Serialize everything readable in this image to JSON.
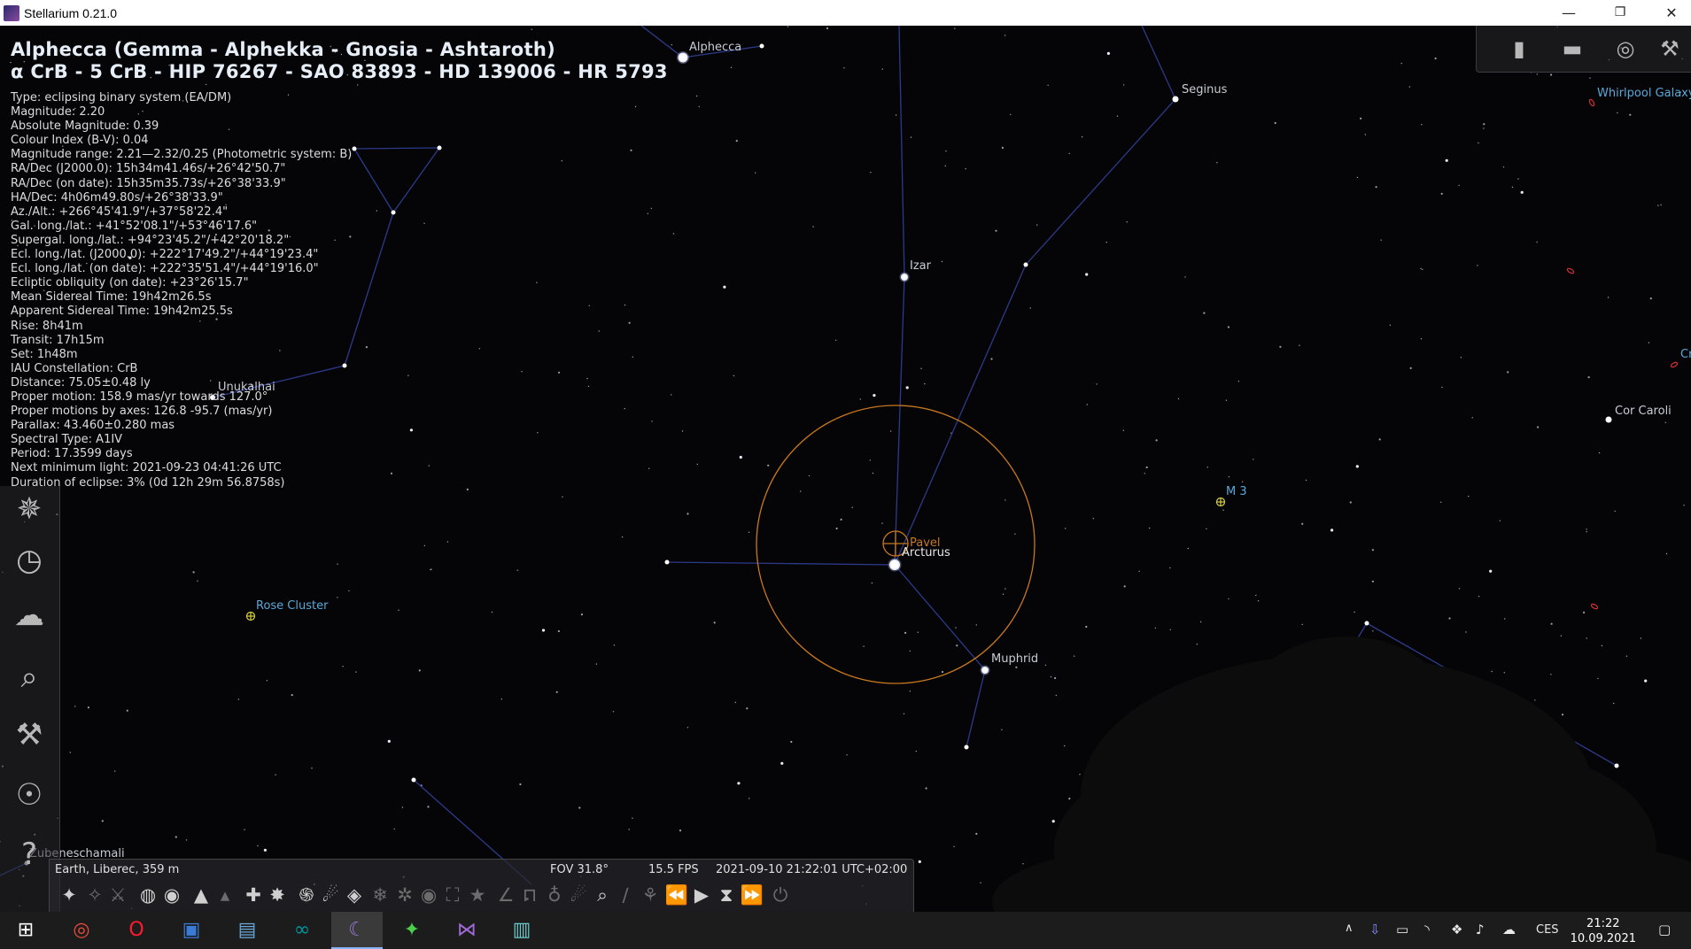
{
  "window": {
    "title": "Stellarium 0.21.0",
    "minimize_glyph": "—",
    "restore_glyph": "❐",
    "close_glyph": "✕"
  },
  "object": {
    "name_line": "Alphecca (Gemma - Alphekka - Gnosia - Ashtaroth)",
    "designations_line": "α CrB - 5 CrB - HIP 76267 - SAO 83893 - HD 139006 - HR 5793",
    "info_lines": [
      "Type: eclipsing binary system (EA/DM)",
      "Magnitude: 2.20",
      "Absolute Magnitude: 0.39",
      "Colour Index (B-V): 0.04",
      "Magnitude range: 2.21—2.32/0.25 (Photometric system: B)",
      "RA/Dec (J2000.0): 15h34m41.46s/+26°42'50.7\"",
      "RA/Dec (on date): 15h35m35.73s/+26°38'33.9\"",
      "HA/Dec: 4h06m49.80s/+26°38'33.9\"",
      "Az./Alt.: +266°45'41.9\"/+37°58'22.4\"",
      "Gal. long./lat.: +41°52'08.1\"/+53°46'17.6\"",
      "Supergal. long./lat.: +94°23'45.2\"/+42°20'18.2\"",
      "Ecl. long./lat. (J2000.0): +222°17'49.2\"/+44°19'23.4\"",
      "Ecl. long./lat. (on date): +222°35'51.4\"/+44°19'16.0\"",
      "Ecliptic obliquity (on date): +23°26'15.7\"",
      "Mean Sidereal Time: 19h42m26.5s",
      "Apparent Sidereal Time: 19h42m25.5s",
      "Rise: 8h41m",
      "Transit: 17h15m",
      "Set: 1h48m",
      "IAU Constellation: CrB",
      "Distance: 75.05±0.48 ly",
      "Proper motion: 158.9 mas/yr towards 127.0°",
      "Proper motions by axes: 126.8 -95.7 (mas/yr)",
      "Parallax: 43.460±0.280 mas",
      "Spectral Type: A1IV",
      "Period: 17.3599 days",
      "Next minimum light: 2021-09-23 04:41:26 UTC",
      "Duration of eclipse: 3% (0d 12h 29m 56.8758s)"
    ]
  },
  "sky_labels": {
    "alphecca": "Alphecca",
    "seginus": "Seginus",
    "izar": "Izar",
    "unukalhai": "Unukalhai",
    "pavel": "Pavel",
    "arcturus": "Arcturus",
    "muphrid": "Muphrid",
    "cor_caroli": "Cor Caroli",
    "m3": "M 3",
    "rose_cluster": "Rose Cluster",
    "whirlpool": "Whirlpool Galaxy",
    "zubeneschamali": "Zubeneschamali",
    "cr": "Cr"
  },
  "status": {
    "location": "Earth, Liberec, 359 m",
    "fov": "FOV 31.8°",
    "fps": "15.5 FPS",
    "datetime": "2021-09-10 21:22:01 UTC+02:00"
  },
  "left_toolbar": [
    {
      "name": "location-window-icon",
      "glyph": "✵"
    },
    {
      "name": "date-time-window-icon",
      "glyph": "◷"
    },
    {
      "name": "sky-viewing-options-icon",
      "glyph": "☁"
    },
    {
      "name": "search-window-icon",
      "glyph": "⌕"
    },
    {
      "name": "configuration-window-icon",
      "glyph": "⚒"
    },
    {
      "name": "astronomical-calculations-icon",
      "glyph": "☉"
    },
    {
      "name": "help-window-icon",
      "glyph": "?"
    }
  ],
  "top_right_buttons": [
    {
      "name": "trash-icon",
      "glyph": "▮"
    },
    {
      "name": "ocular-icon",
      "glyph": "▬"
    },
    {
      "name": "telrad-icon",
      "glyph": "◎"
    },
    {
      "name": "wrench-icon",
      "glyph": "⚒"
    }
  ],
  "bottom_toolbar": [
    {
      "name": "constellation-lines-button",
      "glyph": "✦",
      "dim": false
    },
    {
      "name": "constellation-labels-button",
      "glyph": "✧",
      "dim": true
    },
    {
      "name": "constellation-art-button",
      "glyph": "⚔",
      "dim": true
    },
    {
      "name": "equatorial-grid-button",
      "glyph": "◍",
      "dim": false
    },
    {
      "name": "azimuthal-grid-button",
      "glyph": "◉",
      "dim": false
    },
    {
      "name": "ground-button",
      "glyph": "▲",
      "dim": false
    },
    {
      "name": "cardinal-points-button",
      "glyph": "▴",
      "dim": true
    },
    {
      "name": "atmosphere-button",
      "glyph": "✚",
      "dim": false
    },
    {
      "name": "nebulae-button",
      "glyph": "✸",
      "dim": false
    },
    {
      "name": "galaxy-button",
      "glyph": "֍",
      "dim": false
    },
    {
      "name": "planet-labels-button",
      "glyph": "☄",
      "dim": false
    },
    {
      "name": "exoplanets-button",
      "glyph": "◈",
      "dim": false
    },
    {
      "name": "meteor-showers-button",
      "glyph": "❄",
      "dim": true
    },
    {
      "name": "equatorial-mount-button",
      "glyph": "✲",
      "dim": true
    },
    {
      "name": "night-mode-button",
      "glyph": "◉",
      "dim": true
    },
    {
      "name": "full-screen-button",
      "glyph": "⛶",
      "dim": true
    },
    {
      "name": "bookmarks-button",
      "glyph": "★",
      "dim": true
    },
    {
      "name": "angle-measure-button",
      "glyph": "∠",
      "dim": true
    },
    {
      "name": "archaeo-lines-button",
      "glyph": "⊓",
      "dim": true
    },
    {
      "name": "satellites-button",
      "glyph": "♁",
      "dim": true
    },
    {
      "name": "meteors-button",
      "glyph": "☄",
      "dim": true
    },
    {
      "name": "oculars-button",
      "glyph": "⌕",
      "dim": false
    },
    {
      "name": "telescope-button",
      "glyph": "∕",
      "dim": true
    },
    {
      "name": "scenery-button",
      "glyph": "⚘",
      "dim": true
    },
    {
      "name": "decrease-speed-button",
      "glyph": "⏪",
      "dim": true
    },
    {
      "name": "play-button",
      "glyph": "▶",
      "dim": false
    },
    {
      "name": "real-time-button",
      "glyph": "⧗",
      "dim": false
    },
    {
      "name": "increase-speed-button",
      "glyph": "⏩",
      "dim": true
    },
    {
      "name": "quit-button",
      "glyph": "⏻",
      "dim": true
    }
  ],
  "taskbar": {
    "apps": [
      {
        "name": "start-button",
        "glyph": "⊞",
        "color": "#ffffff",
        "active": false
      },
      {
        "name": "chrome-icon",
        "glyph": "◎",
        "color": "#e84a3c",
        "active": false
      },
      {
        "name": "opera-icon",
        "glyph": "O",
        "color": "#ff1b2d",
        "active": false
      },
      {
        "name": "save-app-icon",
        "glyph": "▣",
        "color": "#3a7bd5",
        "active": false
      },
      {
        "name": "explorer-icon",
        "glyph": "▤",
        "color": "#6aa8d8",
        "active": false
      },
      {
        "name": "arduino-icon",
        "glyph": "∞",
        "color": "#00979c",
        "active": false
      },
      {
        "name": "stellarium-icon",
        "glyph": "☾",
        "color": "#9a7ad8",
        "active": true
      },
      {
        "name": "green-app-icon",
        "glyph": "✦",
        "color": "#4ad04a",
        "active": false
      },
      {
        "name": "visual-studio-icon",
        "glyph": "⋈",
        "color": "#a06ad8",
        "active": false
      },
      {
        "name": "window-app-icon",
        "glyph": "▥",
        "color": "#6ac8c8",
        "active": false
      }
    ],
    "language": "CES",
    "time": "21:22",
    "date": "10.09.2021"
  },
  "colors": {
    "constellation_lines": "#2c3a8a",
    "selection_circle": "#c8781e",
    "dso_label": "#5aa8d8"
  }
}
